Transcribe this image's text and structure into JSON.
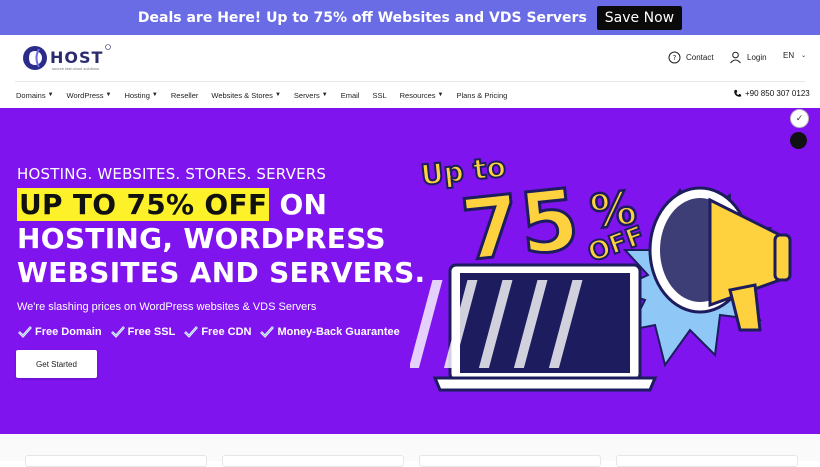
{
  "promo": {
    "text": "Deals are Here! Up to 75% off Websites and VDS Servers",
    "button": "Save Now"
  },
  "header": {
    "logo": {
      "text": "HOST",
      "tagline": "secure fast cloud solutions"
    },
    "contact": "Contact",
    "login": "Login",
    "language": "EN"
  },
  "nav": {
    "items": [
      {
        "label": "Domains",
        "dropdown": true
      },
      {
        "label": "WordPress",
        "dropdown": true
      },
      {
        "label": "Hosting",
        "dropdown": true
      },
      {
        "label": "Reseller",
        "dropdown": false
      },
      {
        "label": "Websites & Stores",
        "dropdown": true
      },
      {
        "label": "Servers",
        "dropdown": true
      },
      {
        "label": "Email",
        "dropdown": false
      },
      {
        "label": "SSL",
        "dropdown": false
      },
      {
        "label": "Resources",
        "dropdown": true
      },
      {
        "label": "Plans & Pricing",
        "dropdown": false
      }
    ],
    "phone": "+90 850 307 0123"
  },
  "hero": {
    "kicker": "HOSTING. WEBSITES. STORES. SERVERS",
    "headline_highlight": "UP TO 75% OFF",
    "headline_rest1": " ON",
    "headline_line2": "HOSTING, WORDPRESS",
    "headline_line3": "WEBSITES AND SERVERS.",
    "subtitle": "We're slashing prices on WordPress websites & VDS Servers",
    "features": [
      "Free Domain",
      "Free SSL",
      "Free CDN",
      "Money-Back Guarantee"
    ],
    "cta": "Get Started",
    "art": {
      "line1": "Up to",
      "line2": "75",
      "line3": "%",
      "line4": "OFF"
    }
  },
  "colors": {
    "promo": "#6a6ce6",
    "hero": "#7f14ef",
    "highlight": "#fdf22a",
    "art_yellow": "#fdd23e"
  }
}
